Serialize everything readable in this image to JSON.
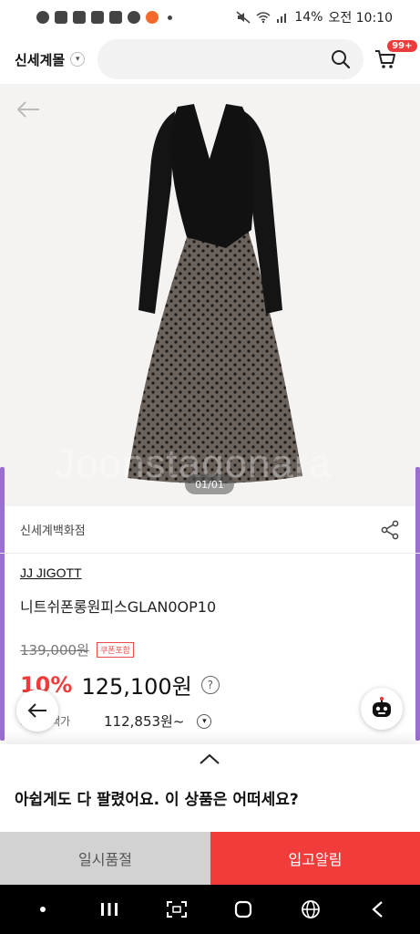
{
  "status_bar": {
    "battery": "14%",
    "time": "오전 10:10"
  },
  "header": {
    "brand": "신세계몰",
    "search_placeholder": "",
    "cart_badge": "99+"
  },
  "gallery": {
    "counter": "01/01",
    "watermark": "Joonstagonara"
  },
  "store": {
    "name": "신세계백화점"
  },
  "product": {
    "brand": "JJ JIGOTT",
    "name": "니트쉬폰롱원피스GLAN0OP10",
    "original_price": "139,000원",
    "coupon_label": "쿠폰포함",
    "discount": "10%",
    "price": "125,100원",
    "card_label": "카드혜택가",
    "card_price": "112,853원~"
  },
  "sheet": {
    "message": "아쉽게도 다 팔렸어요. 이 상품은 어떠세요?"
  },
  "actions": {
    "sold_out": "일시품절",
    "restock_alert": "입고알림"
  },
  "colors": {
    "accent_red": "#f23b3b",
    "side_purple": "#9b6fd0"
  }
}
